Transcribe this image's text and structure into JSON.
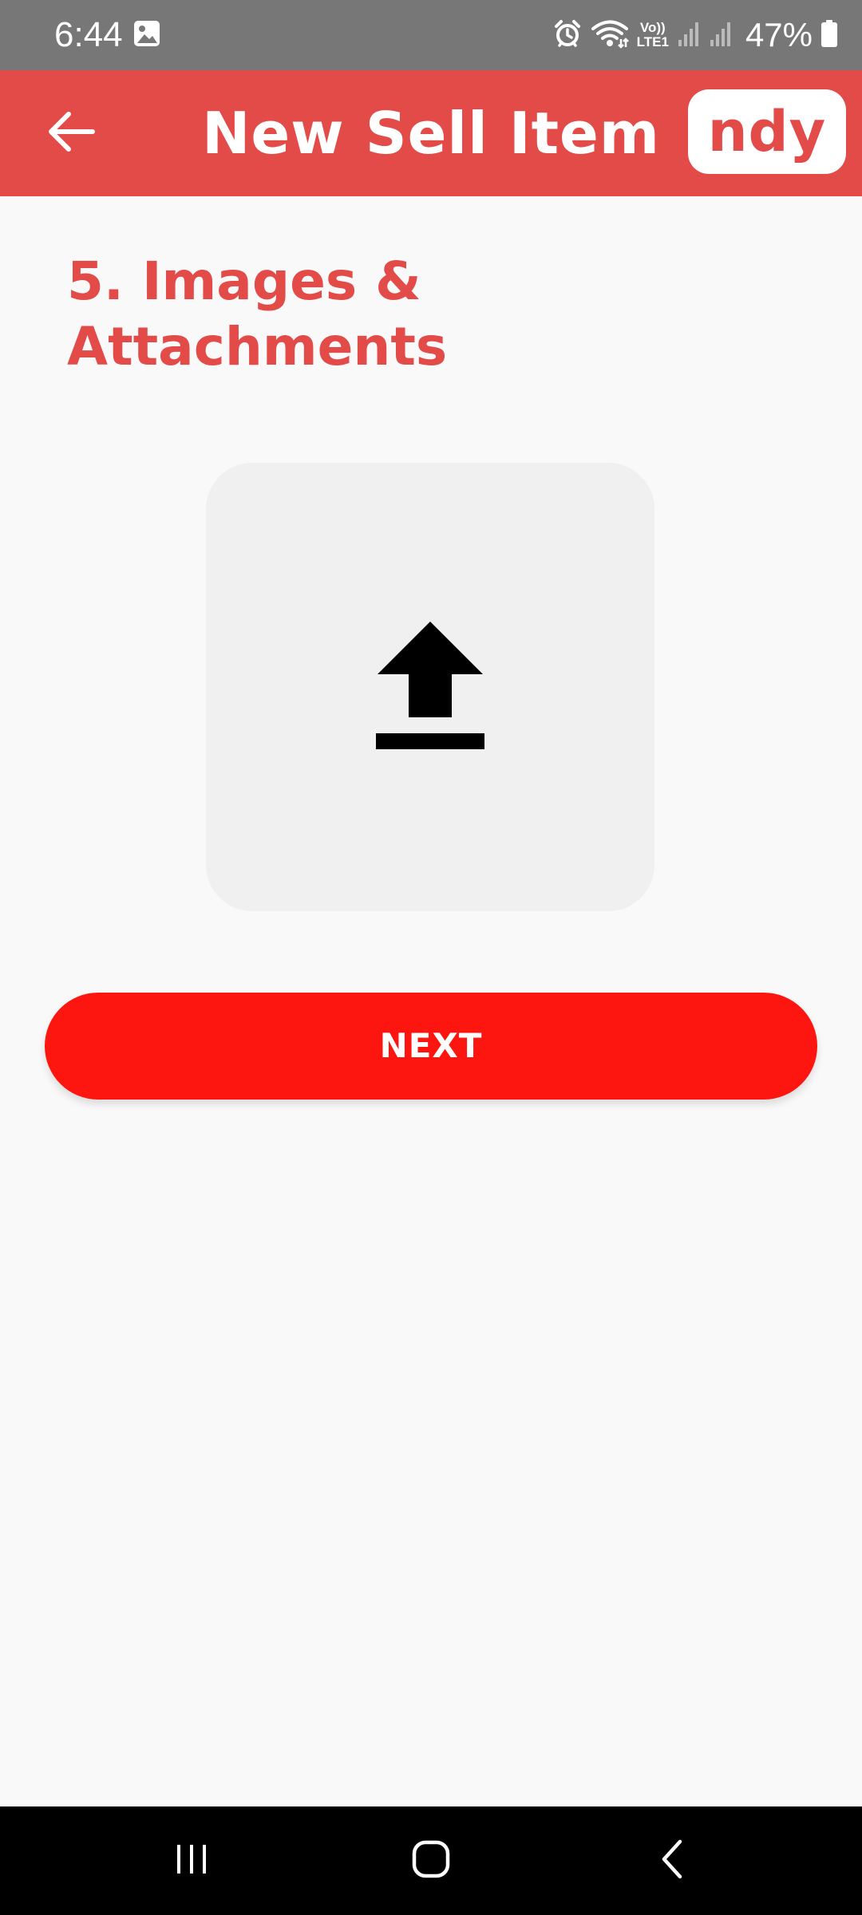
{
  "status_bar": {
    "time": "6:44",
    "battery": "47%",
    "icons": [
      "gallery-icon",
      "alarm-icon",
      "wifi-icon",
      "volte-icon",
      "signal-icon",
      "battery-icon"
    ],
    "volte_top": "Vo))",
    "volte_bottom": "LTE1"
  },
  "app_bar": {
    "title": "New Sell Item",
    "brand": "ndy",
    "back_icon": "arrow-left-icon",
    "color": "#e34b48"
  },
  "section": {
    "title": "5. Images & Attachments"
  },
  "upload": {
    "icon": "upload-icon"
  },
  "next_button": {
    "label": "NEXT",
    "color": "#fd1610"
  },
  "nav_bar": {
    "items": [
      "recent-apps-icon",
      "home-icon",
      "back-icon"
    ]
  }
}
